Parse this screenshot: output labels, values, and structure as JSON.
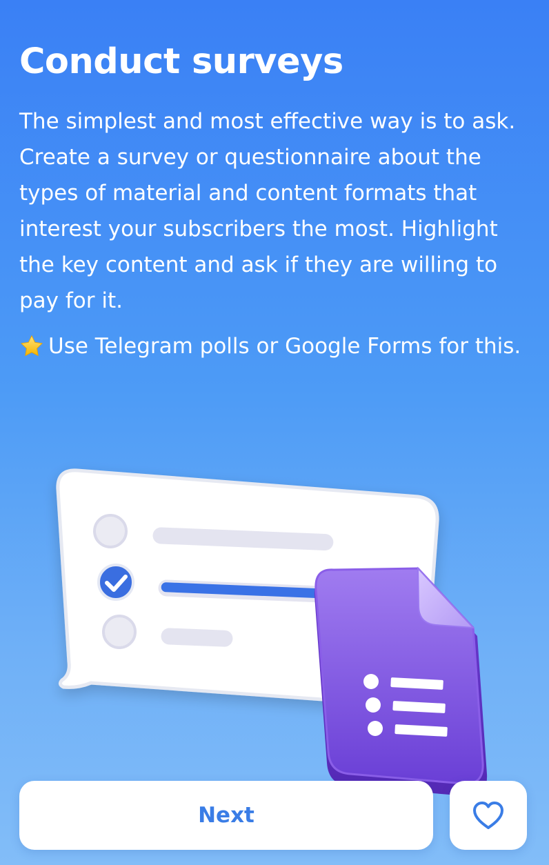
{
  "screen": {
    "title": "Conduct surveys",
    "description": "The simplest and most effective way is to ask. Create a survey or questionnaire about the types of material and content formats that interest your subscribers the most. Highlight the key content and ask if they are willing to pay for it.",
    "tip": {
      "icon": "star-icon",
      "text": "Use Telegram polls or Google Forms for this."
    }
  },
  "illustration": {
    "poll_card": {
      "options": [
        {
          "checked": false
        },
        {
          "checked": true
        },
        {
          "checked": false
        }
      ]
    },
    "forms_icon": "google-forms-icon"
  },
  "actions": {
    "next_label": "Next",
    "favorite_icon": "heart-icon"
  },
  "colors": {
    "background_top": "#3a80f5",
    "background_bottom": "#82bdf8",
    "accent": "#3a7de6",
    "forms_purple": "#7b4fe0"
  }
}
